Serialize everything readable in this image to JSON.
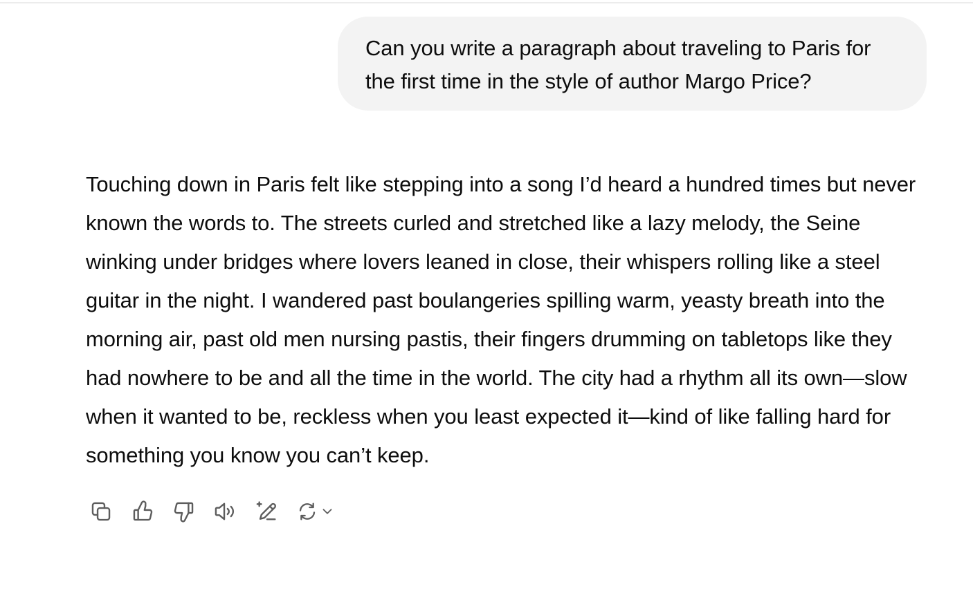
{
  "conversation": {
    "user_message": "Can you write a paragraph about traveling to Paris for the first time in the style of author Margo Price?",
    "assistant_message": "Touching down in Paris felt like stepping into a song I’d heard a hundred times but never known the words to. The streets curled and stretched like a lazy melody, the Seine winking under bridges where lovers leaned in close, their whispers rolling like a steel guitar in the night. I wandered past boulangeries spilling warm, yeasty breath into the morning air, past old men nursing pastis, their fingers drumming on tabletops like they had nowhere to be and all the time in the world. The city had a rhythm all its own—slow when it wanted to be, reckless when you least expected it—kind of like falling hard for something you know you can’t keep."
  },
  "actions": [
    {
      "icon": "copy-icon"
    },
    {
      "icon": "thumbs-up-icon"
    },
    {
      "icon": "thumbs-down-icon"
    },
    {
      "icon": "read-aloud-icon"
    },
    {
      "icon": "edit-canvas-icon"
    },
    {
      "icon": "regenerate-icon"
    }
  ],
  "colors": {
    "background": "#ffffff",
    "user_bubble": "#f3f3f3",
    "text": "#0d0d0d",
    "icon": "#5d5d5d"
  }
}
